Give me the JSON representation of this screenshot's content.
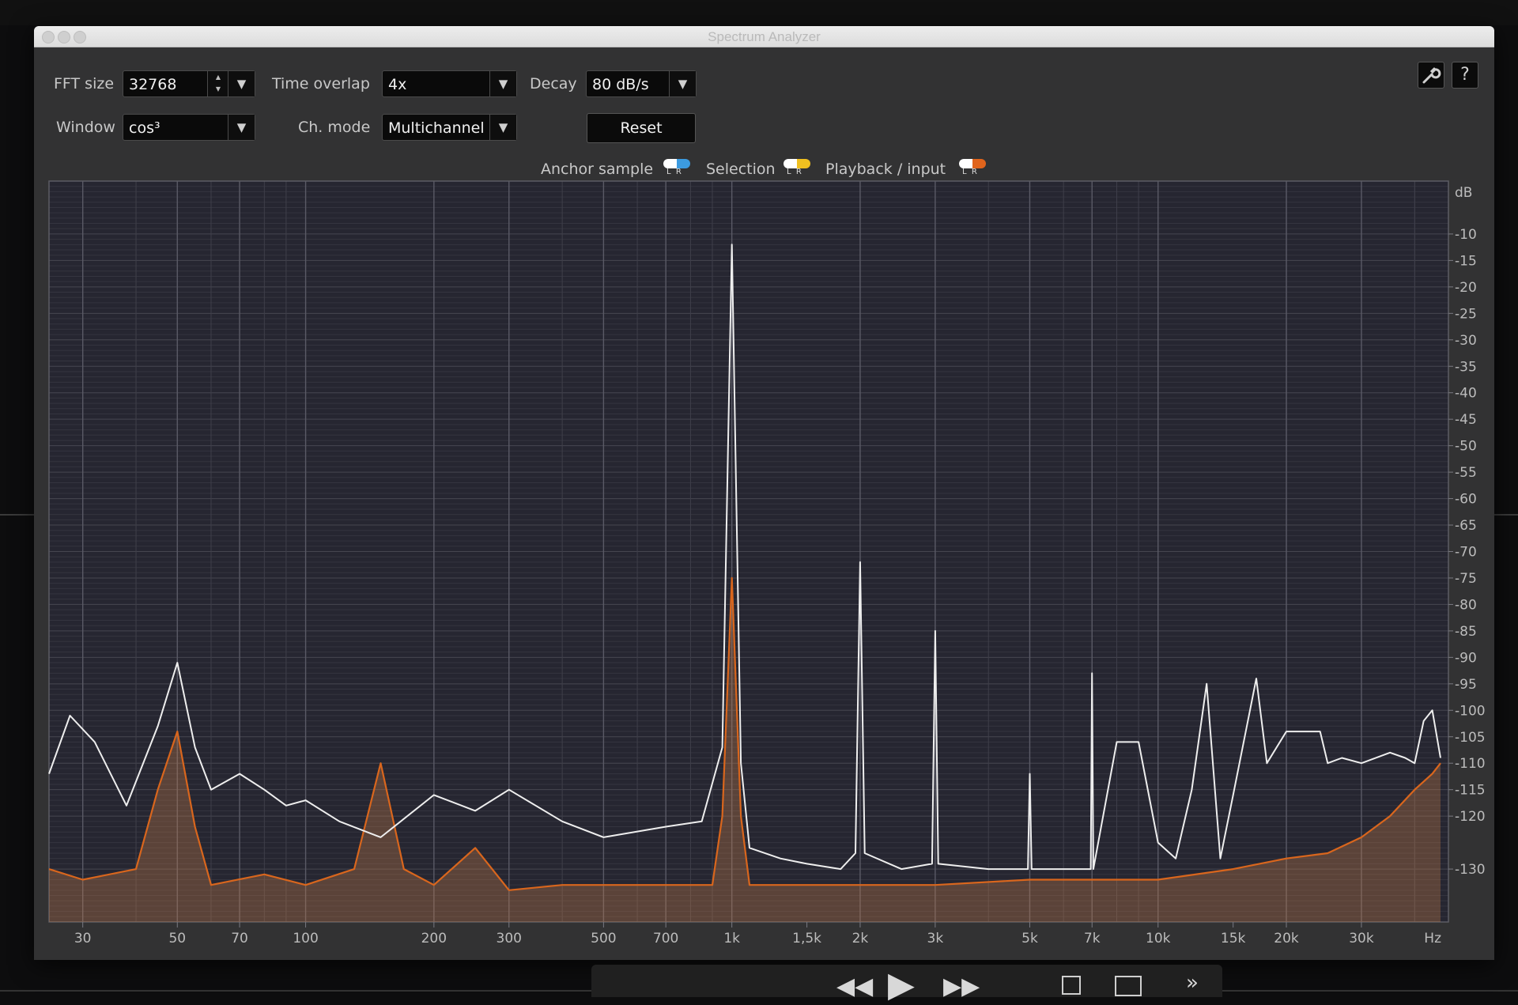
{
  "window": {
    "title": "Spectrum Analyzer"
  },
  "controls": {
    "fft_size_label": "FFT size",
    "fft_size_value": "32768",
    "time_overlap_label": "Time overlap",
    "time_overlap_value": "4x",
    "decay_label": "Decay",
    "decay_value": "80 dB/s",
    "window_label": "Window",
    "window_value": "cos³",
    "ch_mode_label": "Ch. mode",
    "ch_mode_value": "Multichannel",
    "reset_label": "Reset",
    "settings_icon": "wrench-icon",
    "help_label": "?"
  },
  "legend": [
    {
      "label": "Anchor sample",
      "color_l": "#ffffff",
      "color_r": "#3c9be0"
    },
    {
      "label": "Selection",
      "color_l": "#ffffff",
      "color_r": "#f0c020"
    },
    {
      "label": "Playback / input",
      "color_l": "#ffffff",
      "color_r": "#e0641c"
    }
  ],
  "legend_channel_labels": [
    "L",
    "R"
  ],
  "colors": {
    "plot_bg": "#262631",
    "grid": "#45454f",
    "anchor": "#eeeeee",
    "playback": "#d9661d",
    "fill": "#c07a4b"
  },
  "chart_data": {
    "type": "line",
    "title": "",
    "xlabel": "Hz",
    "ylabel": "dB",
    "x_scale": "log",
    "y_scale": "linear",
    "xlim": [
      25,
      48000
    ],
    "ylim": [
      -140,
      0
    ],
    "x_ticks": [
      {
        "v": 30,
        "label": "30"
      },
      {
        "v": 50,
        "label": "50"
      },
      {
        "v": 70,
        "label": "70"
      },
      {
        "v": 100,
        "label": "100"
      },
      {
        "v": 200,
        "label": "200"
      },
      {
        "v": 300,
        "label": "300"
      },
      {
        "v": 500,
        "label": "500"
      },
      {
        "v": 700,
        "label": "700"
      },
      {
        "v": 1000,
        "label": "1k"
      },
      {
        "v": 1500,
        "label": "1,5k"
      },
      {
        "v": 2000,
        "label": "2k"
      },
      {
        "v": 3000,
        "label": "3k"
      },
      {
        "v": 5000,
        "label": "5k"
      },
      {
        "v": 7000,
        "label": "7k"
      },
      {
        "v": 10000,
        "label": "10k"
      },
      {
        "v": 15000,
        "label": "15k"
      },
      {
        "v": 20000,
        "label": "20k"
      },
      {
        "v": 30000,
        "label": "30k"
      }
    ],
    "y_ticks": [
      {
        "v": -10,
        "label": "-10"
      },
      {
        "v": -15,
        "label": "-15"
      },
      {
        "v": -20,
        "label": "-20"
      },
      {
        "v": -25,
        "label": "-25"
      },
      {
        "v": -30,
        "label": "-30"
      },
      {
        "v": -35,
        "label": "-35"
      },
      {
        "v": -40,
        "label": "-40"
      },
      {
        "v": -45,
        "label": "-45"
      },
      {
        "v": -50,
        "label": "-50"
      },
      {
        "v": -55,
        "label": "-55"
      },
      {
        "v": -60,
        "label": "-60"
      },
      {
        "v": -65,
        "label": "-65"
      },
      {
        "v": -70,
        "label": "-70"
      },
      {
        "v": -75,
        "label": "-75"
      },
      {
        "v": -80,
        "label": "-80"
      },
      {
        "v": -85,
        "label": "-85"
      },
      {
        "v": -90,
        "label": "-90"
      },
      {
        "v": -95,
        "label": "-95"
      },
      {
        "v": -100,
        "label": "-100"
      },
      {
        "v": -105,
        "label": "-105"
      },
      {
        "v": -110,
        "label": "-110"
      },
      {
        "v": -115,
        "label": "-115"
      },
      {
        "v": -120,
        "label": "-120"
      },
      {
        "v": -130,
        "label": "-130"
      }
    ],
    "series": [
      {
        "name": "Anchor sample",
        "points": [
          [
            25,
            -112
          ],
          [
            28,
            -101
          ],
          [
            32,
            -106
          ],
          [
            38,
            -118
          ],
          [
            45,
            -103
          ],
          [
            50,
            -91
          ],
          [
            55,
            -107
          ],
          [
            60,
            -115
          ],
          [
            70,
            -112
          ],
          [
            80,
            -115
          ],
          [
            90,
            -118
          ],
          [
            100,
            -117
          ],
          [
            120,
            -121
          ],
          [
            150,
            -124
          ],
          [
            200,
            -116
          ],
          [
            250,
            -119
          ],
          [
            300,
            -115
          ],
          [
            400,
            -121
          ],
          [
            500,
            -124
          ],
          [
            700,
            -122
          ],
          [
            850,
            -121
          ],
          [
            950,
            -107
          ],
          [
            1000,
            -12
          ],
          [
            1050,
            -110
          ],
          [
            1100,
            -126
          ],
          [
            1300,
            -128
          ],
          [
            1500,
            -129
          ],
          [
            1800,
            -130
          ],
          [
            1950,
            -127
          ],
          [
            2000,
            -72
          ],
          [
            2050,
            -127
          ],
          [
            2500,
            -130
          ],
          [
            2950,
            -129
          ],
          [
            3000,
            -85
          ],
          [
            3050,
            -129
          ],
          [
            4000,
            -130
          ],
          [
            4950,
            -130
          ],
          [
            5000,
            -112
          ],
          [
            5050,
            -130
          ],
          [
            6000,
            -130
          ],
          [
            6950,
            -130
          ],
          [
            7000,
            -93
          ],
          [
            7050,
            -130
          ],
          [
            8000,
            -106
          ],
          [
            9000,
            -106
          ],
          [
            10000,
            -125
          ],
          [
            11000,
            -128
          ],
          [
            12000,
            -115
          ],
          [
            13000,
            -95
          ],
          [
            14000,
            -128
          ],
          [
            15000,
            -116
          ],
          [
            17000,
            -94
          ],
          [
            18000,
            -110
          ],
          [
            20000,
            -104
          ],
          [
            22000,
            -104
          ],
          [
            24000,
            -104
          ],
          [
            25000,
            -110
          ],
          [
            27000,
            -109
          ],
          [
            30000,
            -110
          ],
          [
            35000,
            -108
          ],
          [
            38000,
            -109
          ],
          [
            40000,
            -110
          ],
          [
            42000,
            -102
          ],
          [
            44000,
            -100
          ],
          [
            46000,
            -109
          ]
        ]
      },
      {
        "name": "Playback / input",
        "points": [
          [
            25,
            -130
          ],
          [
            30,
            -132
          ],
          [
            40,
            -130
          ],
          [
            45,
            -115
          ],
          [
            50,
            -104
          ],
          [
            55,
            -122
          ],
          [
            60,
            -133
          ],
          [
            80,
            -131
          ],
          [
            100,
            -133
          ],
          [
            130,
            -130
          ],
          [
            150,
            -110
          ],
          [
            170,
            -130
          ],
          [
            200,
            -133
          ],
          [
            250,
            -126
          ],
          [
            300,
            -134
          ],
          [
            400,
            -133
          ],
          [
            500,
            -133
          ],
          [
            700,
            -133
          ],
          [
            900,
            -133
          ],
          [
            950,
            -120
          ],
          [
            1000,
            -75
          ],
          [
            1050,
            -120
          ],
          [
            1100,
            -133
          ],
          [
            2000,
            -133
          ],
          [
            3000,
            -133
          ],
          [
            5000,
            -132
          ],
          [
            10000,
            -132
          ],
          [
            15000,
            -130
          ],
          [
            20000,
            -128
          ],
          [
            25000,
            -127
          ],
          [
            30000,
            -124
          ],
          [
            35000,
            -120
          ],
          [
            40000,
            -115
          ],
          [
            44000,
            -112
          ],
          [
            46000,
            -110
          ]
        ]
      }
    ]
  },
  "transport": {
    "rewind_icon": "rewind-icon",
    "play_icon": "play-icon",
    "forward_icon": "fast-forward-icon",
    "stop_icon": "stop-icon",
    "loop_icon": "loop-icon",
    "more_icon": "more-icon"
  }
}
